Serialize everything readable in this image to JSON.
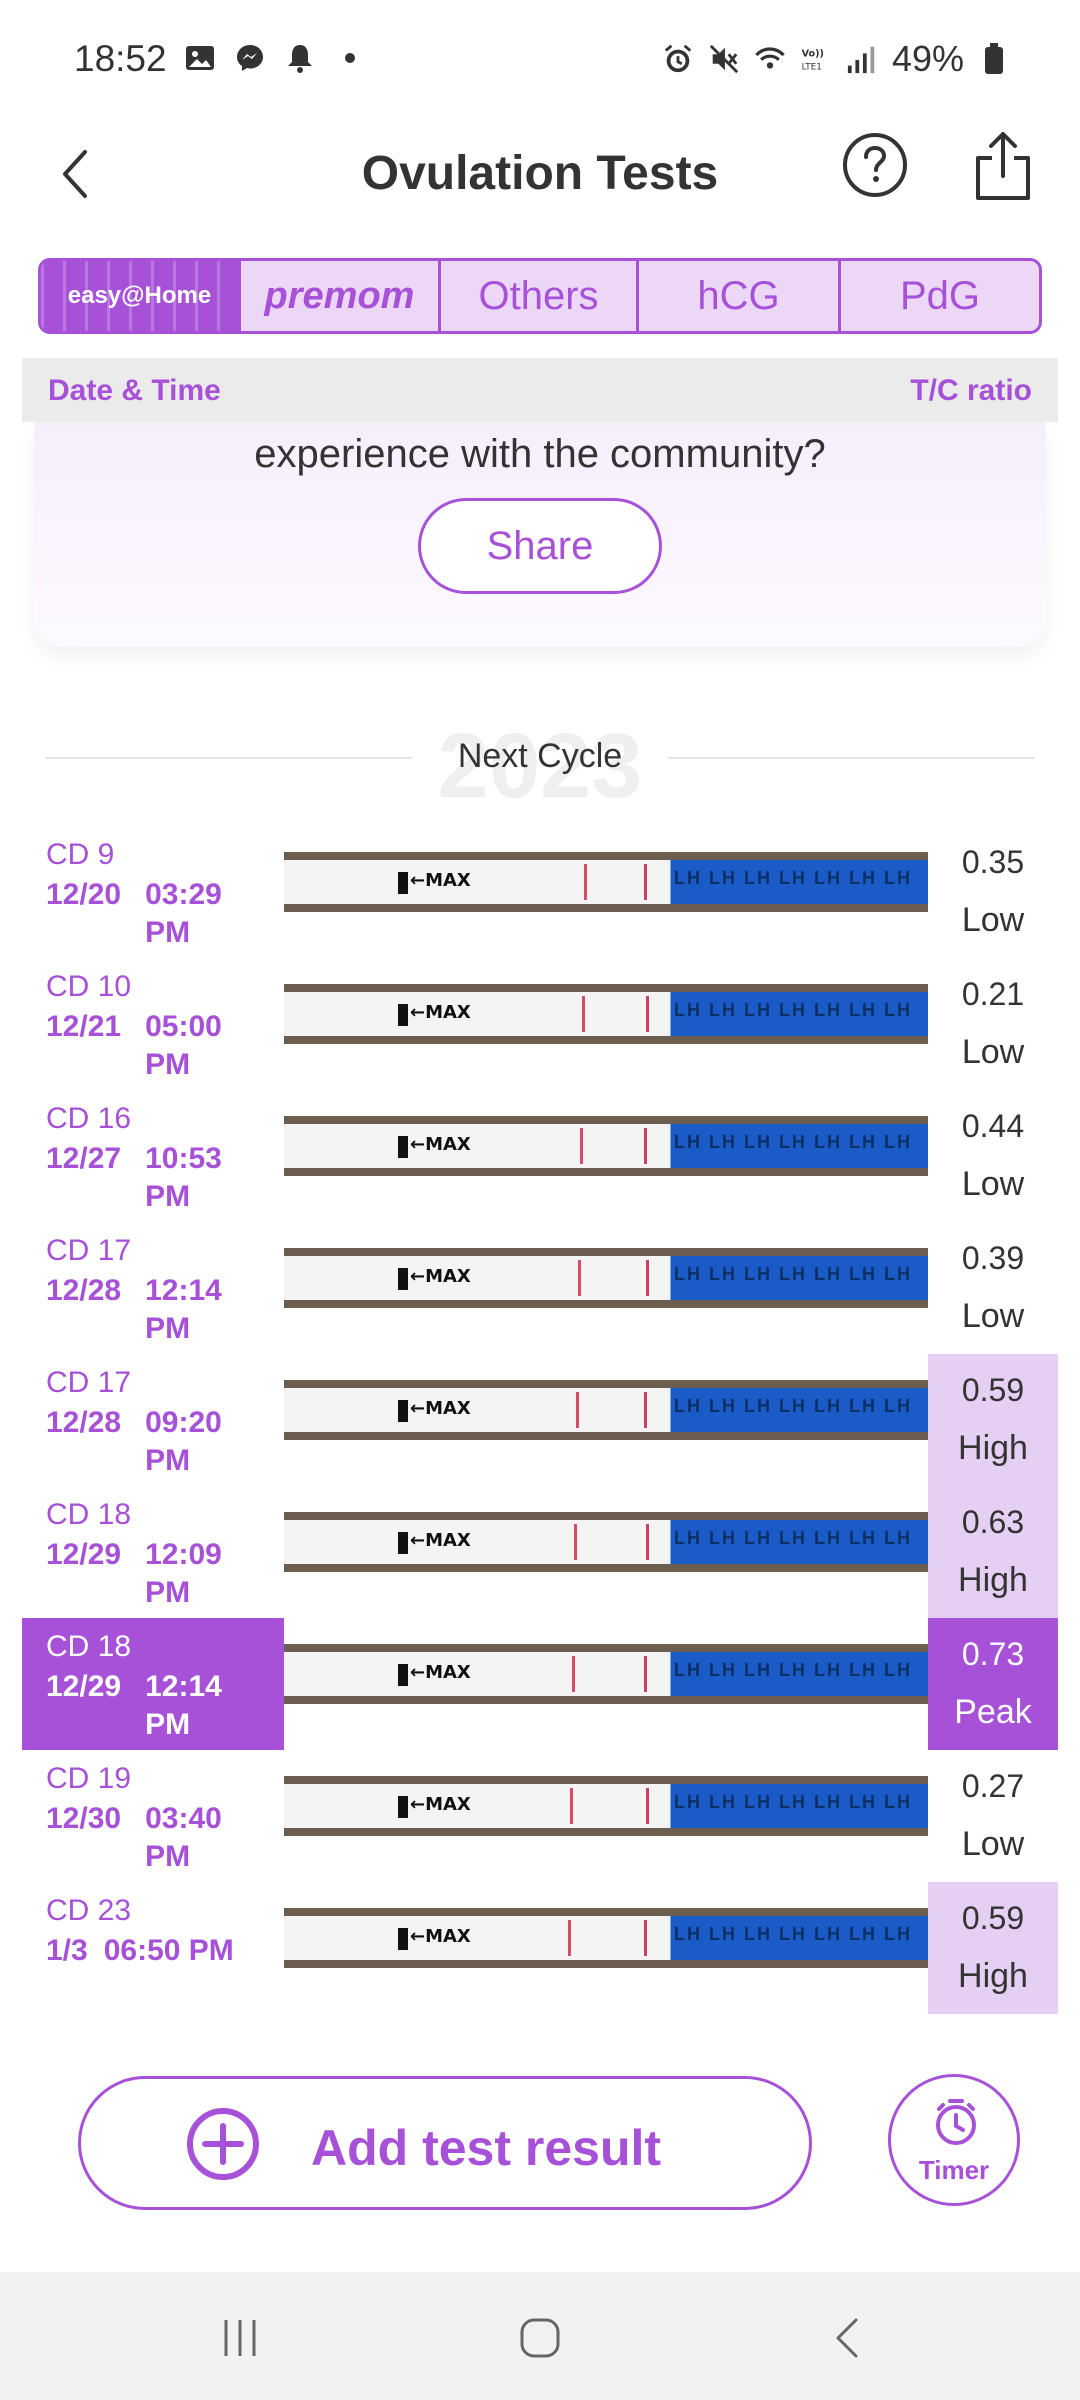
{
  "status_bar": {
    "time": "18:52",
    "battery": "49%",
    "icons_left": [
      "image-icon",
      "messenger-icon",
      "bell-icon",
      "dot-icon"
    ],
    "icons_right": [
      "alarm-icon",
      "mute-icon",
      "wifi-icon",
      "volte-icon",
      "signal-icon",
      "battery-icon"
    ]
  },
  "header": {
    "title": "Ovulation Tests"
  },
  "tabs": [
    {
      "label": "easy@Home",
      "selected": true
    },
    {
      "label": "premom",
      "selected": false
    },
    {
      "label": "Others",
      "selected": false
    },
    {
      "label": "hCG",
      "selected": false
    },
    {
      "label": "PdG",
      "selected": false
    }
  ],
  "columns": {
    "left": "Date & Time",
    "right": "T/C ratio"
  },
  "share_card": {
    "text": "experience with the community?",
    "button": "Share"
  },
  "cycle": {
    "label": "Next Cycle",
    "watermark": "2023"
  },
  "tests": [
    {
      "cd": "CD 9",
      "date": "12/20",
      "time": "03:29 PM",
      "ratio": "0.35",
      "level": "Low"
    },
    {
      "cd": "CD 10",
      "date": "12/21",
      "time": "05:00 PM",
      "ratio": "0.21",
      "level": "Low"
    },
    {
      "cd": "CD 16",
      "date": "12/27",
      "time": "10:53 PM",
      "ratio": "0.44",
      "level": "Low"
    },
    {
      "cd": "CD 17",
      "date": "12/28",
      "time": "12:14 PM",
      "ratio": "0.39",
      "level": "Low"
    },
    {
      "cd": "CD 17",
      "date": "12/28",
      "time": "09:20 PM",
      "ratio": "0.59",
      "level": "High"
    },
    {
      "cd": "CD 18",
      "date": "12/29",
      "time": "12:09 PM",
      "ratio": "0.63",
      "level": "High"
    },
    {
      "cd": "CD 18",
      "date": "12/29",
      "time": "12:14 PM",
      "ratio": "0.73",
      "level": "Peak",
      "selected": true
    },
    {
      "cd": "CD 19",
      "date": "12/30",
      "time": "03:40 PM",
      "ratio": "0.27",
      "level": "Low"
    },
    {
      "cd": "CD 23",
      "date": "1/3",
      "time": "06:50 PM",
      "ratio": "0.59",
      "level": "High"
    }
  ],
  "strip_text": {
    "max": "MAX",
    "lh": "LH LH LH LH LH LH LH"
  },
  "actions": {
    "add": "Add test result",
    "timer": "Timer"
  },
  "colors": {
    "accent": "#a651d8",
    "high_bg": "#e5d0f4",
    "tab_bg": "#ecd8f6"
  }
}
